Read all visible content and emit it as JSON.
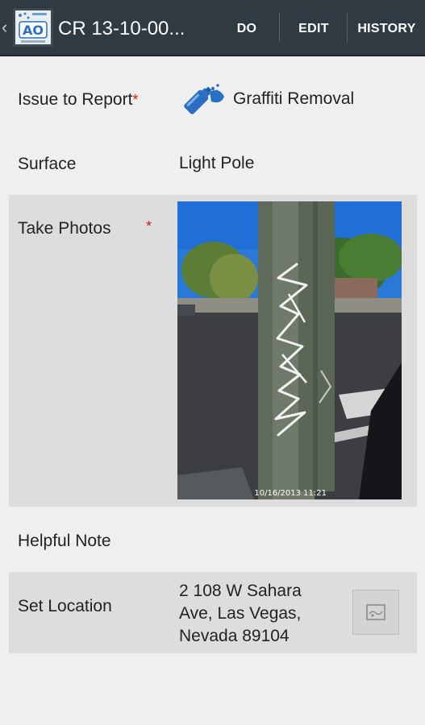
{
  "header": {
    "back_glyph": "‹",
    "logo_text": "AO",
    "title": "CR 13-10-00...",
    "actions": {
      "do": "DO",
      "edit": "EDIT",
      "history": "HISTORY"
    }
  },
  "form": {
    "issue": {
      "label": "Issue to Report",
      "required_mark": "*",
      "icon": "spray-can-icon",
      "value": "Graffiti Removal"
    },
    "surface": {
      "label": "Surface",
      "value": "Light Pole"
    },
    "photos": {
      "label": "Take Photos",
      "required_mark": "*",
      "timestamp": "10/16/2013 11:21"
    },
    "note": {
      "label": "Helpful Note"
    },
    "location": {
      "label": "Set Location",
      "address_line1": "2 108 W Sahara",
      "address_line2": "Ave, Las Vegas,",
      "address_line3": "Nevada 89104",
      "button_icon": "map-icon"
    }
  },
  "colors": {
    "actionbar": "#2f3a42",
    "required": "#d21c1c",
    "icon_blue": "#2a6fc4",
    "shaded_row": "#dddddd",
    "background": "#efefef"
  }
}
